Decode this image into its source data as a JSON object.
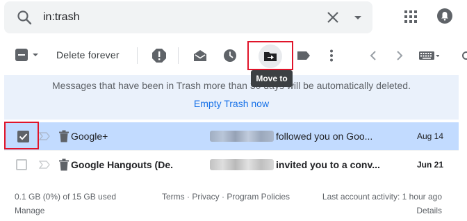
{
  "search": {
    "query": "in:trash"
  },
  "toolbar": {
    "delete_forever_label": "Delete forever",
    "tooltip": "Move to"
  },
  "notice": {
    "message": "Messages that have been in Trash more than 30 days will be automatically deleted.",
    "empty_trash_link": "Empty Trash now"
  },
  "rows": [
    {
      "sender": "Google+",
      "subject": "followed you on Goo...",
      "date": "Aug 14",
      "selected": true,
      "unread": false
    },
    {
      "sender": "Google Hangouts (De.",
      "subject": "invited you to a conv...",
      "date": "Jun 21",
      "selected": false,
      "unread": true
    }
  ],
  "footer": {
    "storage": "0.1 GB (0%) of 15 GB used",
    "manage": "Manage",
    "links": "Terms · Privacy · Program Policies",
    "last_activity": "Last account activity: 1 hour ago",
    "details": "Details"
  },
  "colors": {
    "selected_row": "#c2dbff",
    "notice_bg": "#eaf1fb",
    "link_blue": "#1a73e8",
    "highlight_red": "#e0142a"
  }
}
